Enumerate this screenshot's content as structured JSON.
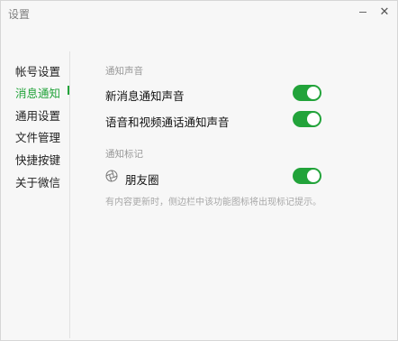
{
  "window": {
    "title": "设置",
    "minimize_glyph": "—",
    "close_glyph": "✕"
  },
  "sidebar": {
    "items": [
      {
        "label": "帐号设置",
        "active": false
      },
      {
        "label": "消息通知",
        "active": true
      },
      {
        "label": "通用设置",
        "active": false
      },
      {
        "label": "文件管理",
        "active": false
      },
      {
        "label": "快捷按键",
        "active": false
      },
      {
        "label": "关于微信",
        "active": false
      }
    ]
  },
  "content": {
    "sound_section": {
      "header": "通知声音",
      "items": [
        {
          "label": "新消息通知声音",
          "enabled": true
        },
        {
          "label": "语音和视频通话通知声音",
          "enabled": true
        }
      ]
    },
    "badge_section": {
      "header": "通知标记",
      "moments": {
        "label": "朋友圈",
        "enabled": true,
        "icon": "moments-icon"
      },
      "hint": "有内容更新时，侧边栏中该功能图标将出现标记提示。"
    }
  },
  "colors": {
    "accent": "#22a33a",
    "background": "#f7f7f7",
    "muted_text": "#9a9a9a"
  }
}
